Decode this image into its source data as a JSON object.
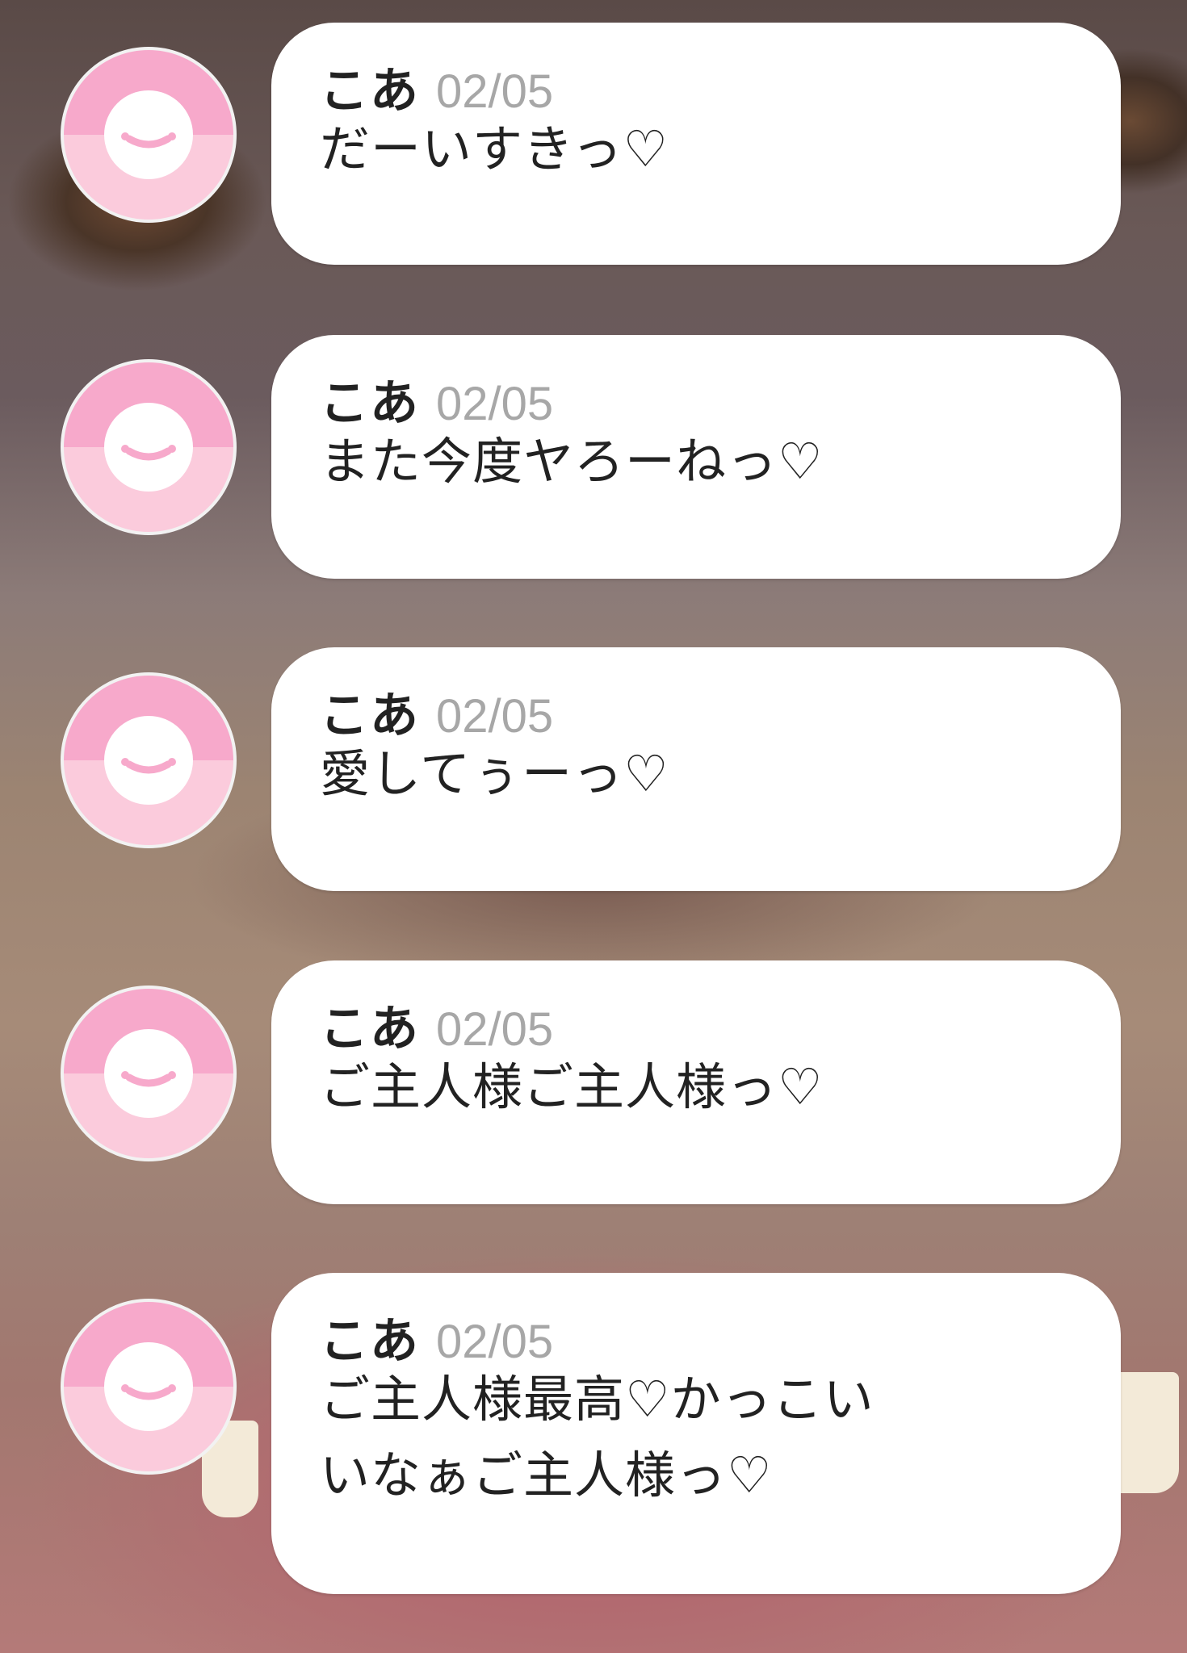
{
  "messages": [
    {
      "sender": "こあ",
      "date": "02/05",
      "text": "だーいすきっ♡"
    },
    {
      "sender": "こあ",
      "date": "02/05",
      "text": "また今度ヤろーねっ♡"
    },
    {
      "sender": "こあ",
      "date": "02/05",
      "text": "愛してぅーっ♡"
    },
    {
      "sender": "こあ",
      "date": "02/05",
      "text": "ご主人様ご主人様っ♡"
    },
    {
      "sender": "こあ",
      "date": "02/05",
      "text": "ご主人様最高♡かっこい\nいなぁご主人様っ♡"
    }
  ],
  "avatar": {
    "icon": "smiley-face-icon",
    "colors": {
      "top": "#f7a9cb",
      "bottom": "#fbcbdc",
      "face": "#ffffff",
      "features": "#f7a9cb"
    }
  }
}
